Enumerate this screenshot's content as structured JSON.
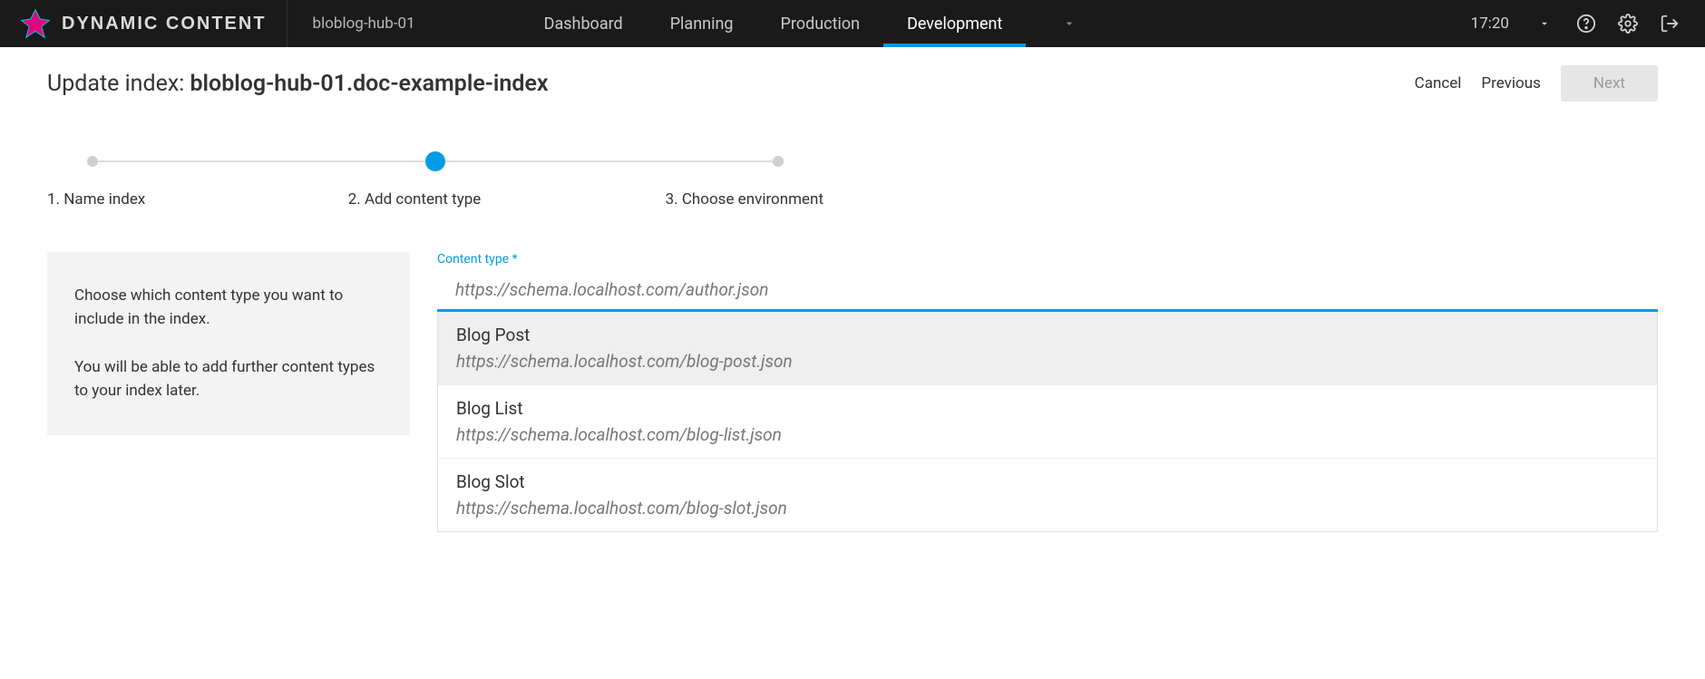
{
  "header": {
    "brand": "DYNAMIC CONTENT",
    "hub": "bloblog-hub-01",
    "nav": [
      "Dashboard",
      "Planning",
      "Production",
      "Development"
    ],
    "active_nav_index": 3,
    "time": "17:20"
  },
  "page": {
    "title_prefix": "Update index: ",
    "title_name": "bloblog-hub-01.doc-example-index",
    "actions": {
      "cancel": "Cancel",
      "previous": "Previous",
      "next": "Next"
    }
  },
  "stepper": {
    "steps": [
      "1. Name index",
      "2. Add content type",
      "3. Choose environment"
    ],
    "active_index": 1
  },
  "info": {
    "p1": "Choose which content type you want to include in the index.",
    "p2": "You will be able to add further content types to your index later."
  },
  "form": {
    "label": "Content type",
    "required_marker": "*",
    "input_value": "https://schema.localhost.com/author.json",
    "options": [
      {
        "title": "Blog Post",
        "schema": "https://schema.localhost.com/blog-post.json",
        "selected": true
      },
      {
        "title": "Blog List",
        "schema": "https://schema.localhost.com/blog-list.json",
        "selected": false
      },
      {
        "title": "Blog Slot",
        "schema": "https://schema.localhost.com/blog-slot.json",
        "selected": false
      }
    ]
  }
}
